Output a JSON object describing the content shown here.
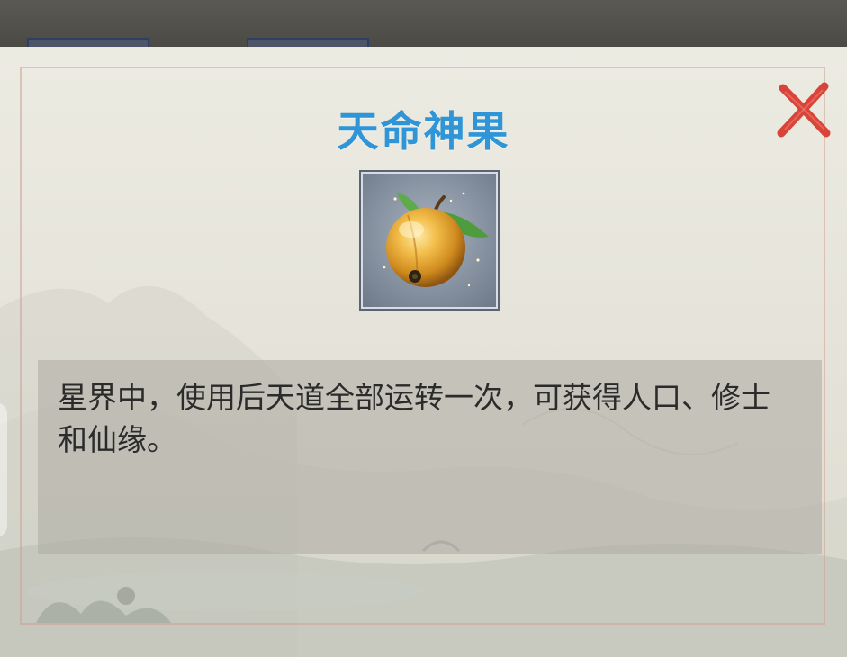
{
  "dialog": {
    "title": "天命神果",
    "close_icon": "close-x-icon",
    "item": {
      "icon": "golden-fruit-icon"
    },
    "description": "星界中，使用后天道全部运转一次，可获得人口、修士和仙缘。"
  },
  "colors": {
    "title": "#2f95d6",
    "close": "#d9443a",
    "panel": "#e8e6dc",
    "description_box": "#b2aea6"
  }
}
